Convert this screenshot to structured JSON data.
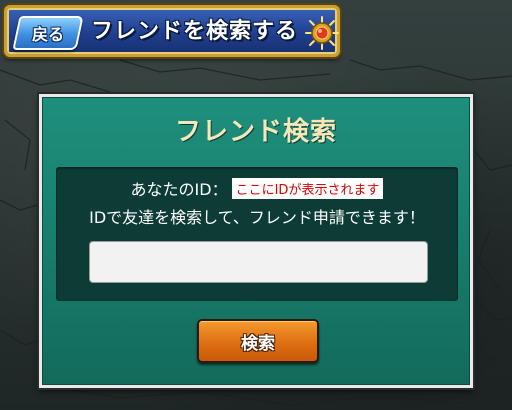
{
  "header": {
    "back_label": "戻る",
    "title": "フレンドを検索する"
  },
  "dialog": {
    "title": "フレンド検索",
    "id_label": "あなたのID：",
    "id_value": "ここにIDが表示されます",
    "instruction": "IDで友達を検索して、フレンド申請できます！",
    "input_value": "",
    "input_placeholder": "",
    "search_button": "検索"
  },
  "colors": {
    "header_bg": "#1f3f8f",
    "header_border": "#c9a033",
    "back_button": "#3f8fe0",
    "dialog_bg": "#177a69",
    "dialog_inner": "#0d3b36",
    "dialog_title_text": "#f4e8b8",
    "id_value_text": "#e00000",
    "search_button": "#df6f12"
  },
  "icons": {
    "header_emblem": "medal-emblem-icon"
  }
}
